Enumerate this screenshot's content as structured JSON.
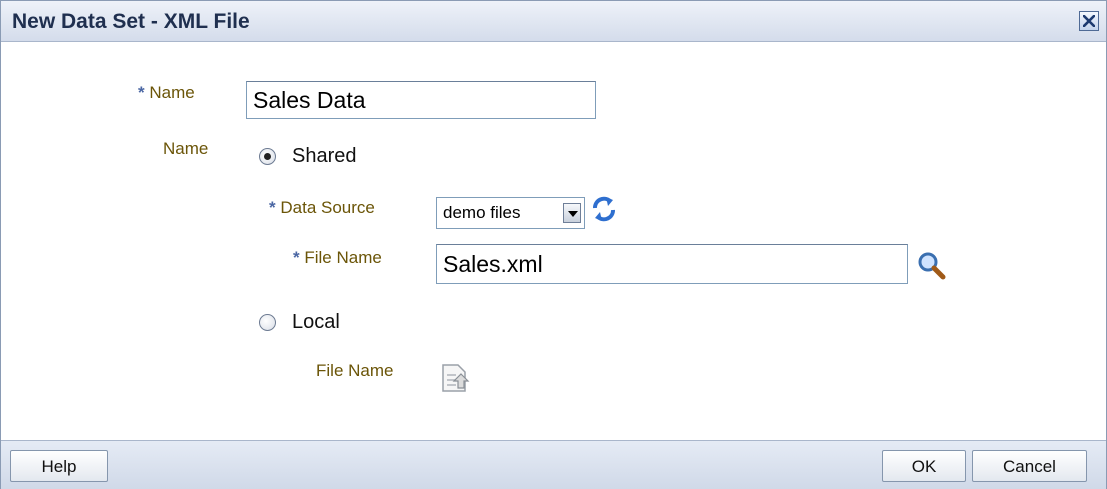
{
  "dialog": {
    "title": "New Data Set - XML File",
    "close_icon": "close-icon"
  },
  "form": {
    "name_required": "*",
    "name_label": "Name",
    "name_value": "Sales Data",
    "location_label": "Name",
    "shared_label": "Shared",
    "shared_selected": true,
    "data_source_required": "*",
    "data_source_label": "Data Source",
    "data_source_value": "demo files",
    "file_name_required": "*",
    "file_name_label": "File Name",
    "file_name_value": "Sales.xml",
    "local_label": "Local",
    "local_selected": false,
    "local_file_name_label": "File Name"
  },
  "footer": {
    "help_label": "Help",
    "ok_label": "OK",
    "cancel_label": "Cancel"
  },
  "colors": {
    "label_text": "#6b5508",
    "required_marker": "#4a66a3",
    "title_bar": "#d4dceb",
    "footer_bar": "#d0d9e8"
  }
}
